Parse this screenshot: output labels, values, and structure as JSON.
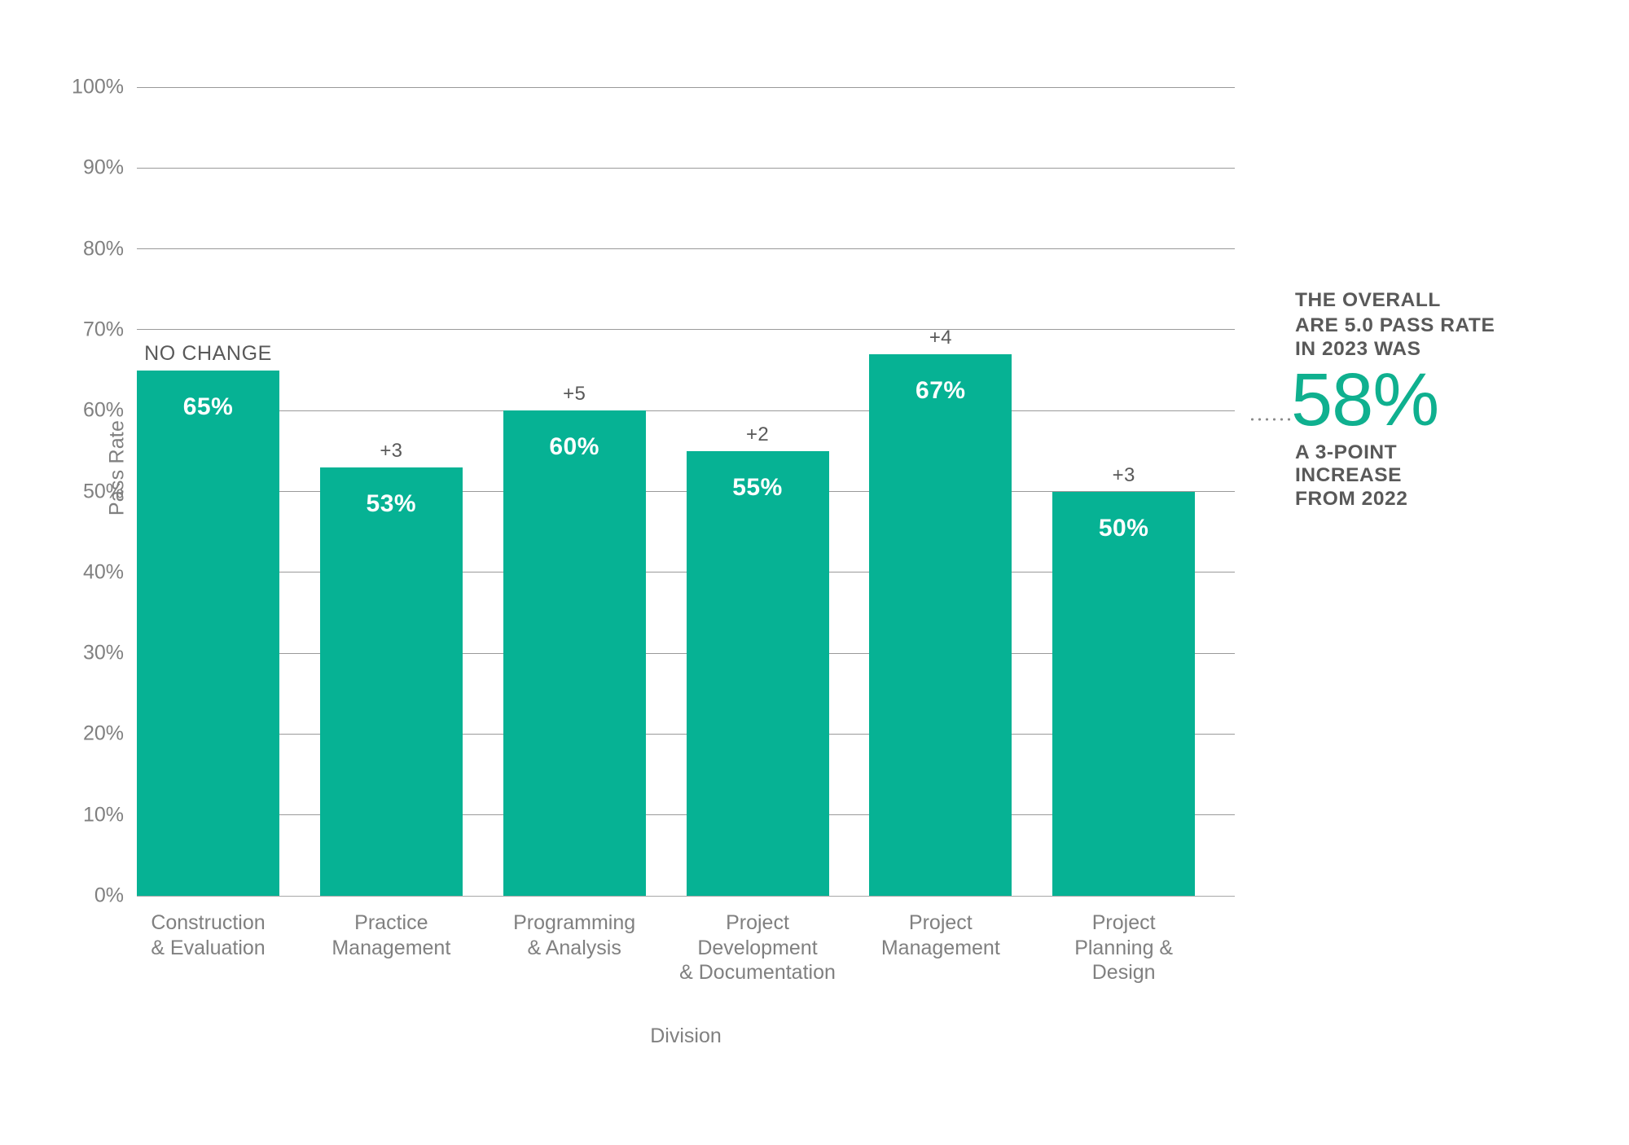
{
  "chart_data": {
    "type": "bar",
    "title": "",
    "subtitle": "",
    "xlabel": "Division",
    "ylabel": "Pass Rate",
    "ylim": [
      0,
      100
    ],
    "y_tick_labels": [
      "0%",
      "10%",
      "20%",
      "30%",
      "40%",
      "50%",
      "60%",
      "70%",
      "80%",
      "90%",
      "100%"
    ],
    "y_tick_values": [
      0,
      10,
      20,
      30,
      40,
      50,
      60,
      70,
      80,
      90,
      100
    ],
    "grid": "horizontal",
    "legend": "none",
    "bar_color": "#06b294",
    "categories": [
      "Construction & Evaluation",
      "Practice Management",
      "Programming & Analysis",
      "Project Development & Documentation",
      "Project Management",
      "Project Planning & Design"
    ],
    "category_lines": [
      [
        "Construction",
        "& Evaluation"
      ],
      [
        "Practice",
        "Management"
      ],
      [
        "Programming",
        "& Analysis"
      ],
      [
        "Project",
        "Development",
        "& Documentation"
      ],
      [
        "Project",
        "Management"
      ],
      [
        "Project",
        "Planning &",
        "Design"
      ]
    ],
    "values": [
      65,
      53,
      60,
      55,
      67,
      50
    ],
    "value_labels": [
      "65%",
      "53%",
      "60%",
      "55%",
      "67%",
      "50%"
    ],
    "change_labels": [
      "NO CHANGE",
      "+3",
      "+5",
      "+2",
      "+4",
      "+3"
    ],
    "change_values": [
      0,
      3,
      5,
      2,
      4,
      3
    ]
  },
  "callout": {
    "line1": "THE OVERALL",
    "line2": "ARE 5.0 PASS RATE",
    "line3": "IN 2023 WAS",
    "big_value": "58%",
    "line4": "A 3-POINT",
    "line5": "INCREASE",
    "line6": "FROM 2022",
    "accent_color": "#0fb08f",
    "text_color": "#595959"
  }
}
